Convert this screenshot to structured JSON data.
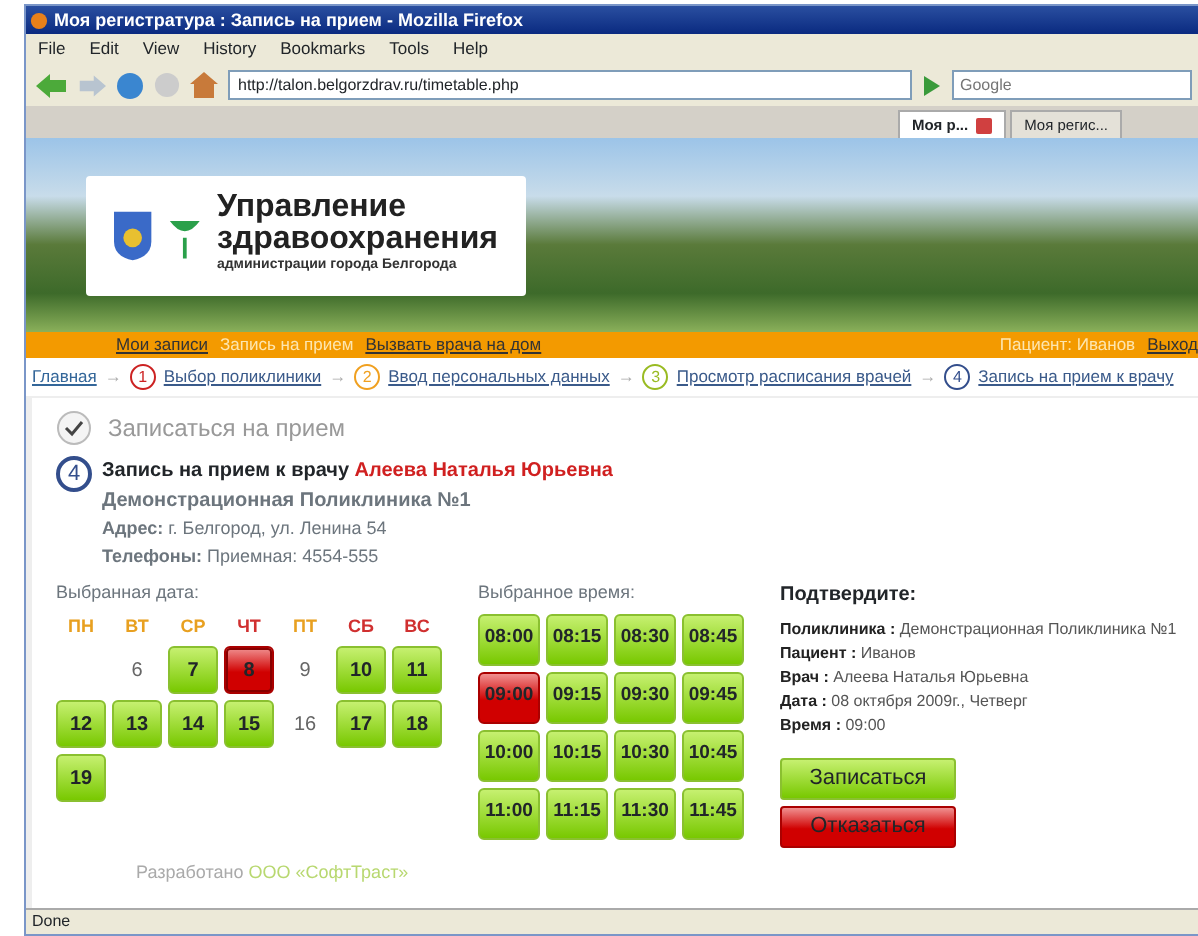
{
  "window": {
    "title": "Моя регистратура : Запись на прием - Mozilla Firefox"
  },
  "menu": [
    "File",
    "Edit",
    "View",
    "History",
    "Bookmarks",
    "Tools",
    "Help"
  ],
  "address_bar": {
    "value": "http://talon.belgorzdrav.ru/timetable.php"
  },
  "search": {
    "placeholder": "Google"
  },
  "tabs": [
    {
      "label": "Моя р...",
      "selected": true
    },
    {
      "label": "Моя регис...",
      "selected": false
    }
  ],
  "banner": {
    "title_lines": [
      "Управление",
      "здравоохранения"
    ],
    "subtitle": "администрации города Белгорода"
  },
  "top_nav": {
    "links": [
      {
        "label": "Мои записи",
        "selected": false
      },
      {
        "label": "Запись на прием",
        "selected": true
      },
      {
        "label": "Вызвать врача на дом",
        "selected": false
      }
    ],
    "patient": "Пациент: Иванов",
    "logout": "Выход"
  },
  "breadcrumb": [
    {
      "label": "Главная",
      "color": "#336699"
    },
    {
      "number": "1",
      "label": "Выбор поликлиники",
      "color": "#cc2222"
    },
    {
      "number": "2",
      "label": "Ввод персональных данных",
      "color": "#f0a020"
    },
    {
      "number": "3",
      "label": "Просмотр расписания врачей",
      "color": "#99bb22"
    },
    {
      "number": "4",
      "label": "Запись на прием к врачу",
      "color": "#334e8c"
    }
  ],
  "breadcrumb_separator": "→",
  "section_title": "Записаться на прием",
  "step": {
    "number": "4",
    "title": "Запись на прием к врачу",
    "doctor": "Алеева Наталья Юрьевна",
    "clinic": "Демонстрационная Поликлиника №1",
    "address_label": "Адрес:",
    "address": "г. Белгород, ул. Ленина 54",
    "phones_label": "Телефоны:",
    "phones": "Приемная: 4554-555"
  },
  "date_picker": {
    "label": "Выбранная дата:",
    "weekdays": [
      {
        "label": "ПН",
        "kind": "workday"
      },
      {
        "label": "ВТ",
        "kind": "workday"
      },
      {
        "label": "СР",
        "kind": "workday"
      },
      {
        "label": "ЧТ",
        "kind": "weekend"
      },
      {
        "label": "ПТ",
        "kind": "workday"
      },
      {
        "label": "СБ",
        "kind": "weekend"
      },
      {
        "label": "ВС",
        "kind": "weekend"
      }
    ],
    "days": [
      {
        "kind": "empty"
      },
      {
        "label": "6",
        "kind": "unavailable"
      },
      {
        "label": "7",
        "kind": "available",
        "selected": false
      },
      {
        "label": "8",
        "kind": "available",
        "selected": true
      },
      {
        "label": "9",
        "kind": "unavailable"
      },
      {
        "label": "10",
        "kind": "available",
        "selected": false
      },
      {
        "label": "11",
        "kind": "available",
        "selected": false
      },
      {
        "label": "12",
        "kind": "available",
        "selected": false
      },
      {
        "label": "13",
        "kind": "available",
        "selected": false
      },
      {
        "label": "14",
        "kind": "available",
        "selected": false
      },
      {
        "label": "15",
        "kind": "available",
        "selected": false
      },
      {
        "label": "16",
        "kind": "unavailable"
      },
      {
        "label": "17",
        "kind": "available",
        "selected": false
      },
      {
        "label": "18",
        "kind": "available",
        "selected": false
      },
      {
        "label": "19",
        "kind": "available",
        "selected": false
      }
    ]
  },
  "time_picker": {
    "label": "Выбранное время:",
    "slots": [
      {
        "label": "08:00",
        "selected": false
      },
      {
        "label": "08:15",
        "selected": false
      },
      {
        "label": "08:30",
        "selected": false
      },
      {
        "label": "08:45",
        "selected": false
      },
      {
        "label": "09:00",
        "selected": true
      },
      {
        "label": "09:15",
        "selected": false
      },
      {
        "label": "09:30",
        "selected": false
      },
      {
        "label": "09:45",
        "selected": false
      },
      {
        "label": "10:00",
        "selected": false
      },
      {
        "label": "10:15",
        "selected": false
      },
      {
        "label": "10:30",
        "selected": false
      },
      {
        "label": "10:45",
        "selected": false
      },
      {
        "label": "11:00",
        "selected": false
      },
      {
        "label": "11:15",
        "selected": false
      },
      {
        "label": "11:30",
        "selected": false
      },
      {
        "label": "11:45",
        "selected": false
      }
    ]
  },
  "confirm": {
    "title": "Подтвердите:",
    "lines": [
      {
        "label": "Поликлиника :",
        "value": "Демонстрационная Поликлиника №1"
      },
      {
        "label": "Пациент :",
        "value": "Иванов"
      },
      {
        "label": "Врач :",
        "value": "Алеева Наталья Юрьевна"
      },
      {
        "label": "Дата :",
        "value": "08 октября 2009г., Четверг"
      },
      {
        "label": "Время :",
        "value": "09:00"
      }
    ],
    "buttons": [
      {
        "label": "Записаться",
        "kind": "primary"
      },
      {
        "label": "Отказаться",
        "kind": "danger"
      }
    ]
  },
  "footer": {
    "text": "Разработано",
    "link": "ООО «СофтТраст»"
  },
  "status_bar": "Done"
}
